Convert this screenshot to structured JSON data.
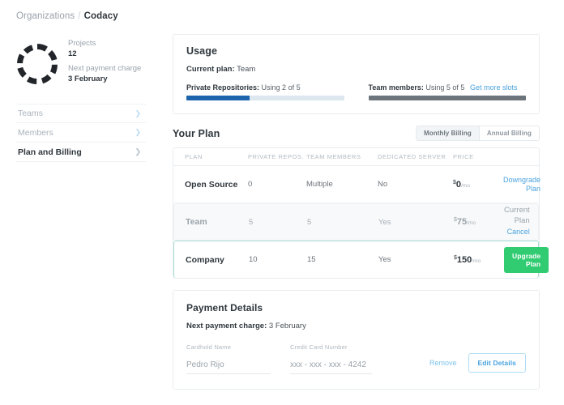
{
  "breadcrumb": {
    "parent": "Organizations",
    "separator": "/",
    "current": "Codacy"
  },
  "org": {
    "logo_icon": "codacy-dashed-circle-logo",
    "projects_label": "Projects",
    "projects_value": "12",
    "next_charge_label": "Next payment charge",
    "next_charge_value": "3 February"
  },
  "sidebar": {
    "items": [
      {
        "label": "Teams",
        "active": false,
        "chevron": "chevron-right-icon"
      },
      {
        "label": "Members",
        "active": false,
        "chevron": "chevron-right-icon"
      },
      {
        "label": "Plan and Billing",
        "active": true,
        "chevron": "chevron-right-icon"
      }
    ]
  },
  "usage": {
    "title": "Usage",
    "current_plan_label": "Current plan:",
    "current_plan_value": "Team",
    "repos": {
      "label": "Private Repositories:",
      "value": "Using 2 of 5",
      "used": 2,
      "total": 5,
      "percent": 40,
      "fill_color": "#1c64ad",
      "track_color": "#dce7ef"
    },
    "members": {
      "label": "Team members:",
      "value": "Using 5 of 5",
      "link": "Get more slots",
      "used": 5,
      "total": 5,
      "percent": 100,
      "fill_color": "#6d757c",
      "track_color": "#d5d9dd"
    }
  },
  "your_plan": {
    "title": "Your Plan",
    "billing_toggle": {
      "monthly": "Monthly Billing",
      "annual": "Annual Billing",
      "selected": "monthly"
    },
    "columns": [
      "PLAN",
      "PRIVATE REPOS.",
      "TEAM MEMBERS",
      "DEDICATED SERVER",
      "PRICE"
    ],
    "rows": [
      {
        "plan": "Open Source",
        "private_repos": "0",
        "team_members": "Multiple",
        "dedicated_server": "No",
        "currency": "$",
        "price": "0",
        "per": "/mo",
        "action_type": "link",
        "action_label": "Downgrade Plan",
        "state": "normal"
      },
      {
        "plan": "Team",
        "private_repos": "5",
        "team_members": "5",
        "dedicated_server": "Yes",
        "currency": "$",
        "price": "75",
        "per": "/mo",
        "action_type": "current",
        "action_label": "Current Plan",
        "action_sub_label": "Cancel",
        "state": "current"
      },
      {
        "plan": "Company",
        "private_repos": "10",
        "team_members": "15",
        "dedicated_server": "Yes",
        "currency": "$",
        "price": "150",
        "per": "/mo",
        "action_type": "button",
        "action_label": "Upgrade Plan",
        "state": "highlight"
      }
    ]
  },
  "payment": {
    "title": "Payment Details",
    "next_charge_label": "Next payment charge:",
    "next_charge_value": "3 February",
    "cardhold_name_label": "Cardhold Name",
    "cardhold_name_value": "Pedro Rijo",
    "card_number_label": "Credit Card Number",
    "card_number_value": "xxx - xxx - xxx - 4242",
    "remove_label": "Remove",
    "edit_label": "Edit Details"
  },
  "colors": {
    "accent_blue": "#4aa3df",
    "accent_green": "#31cb72",
    "highlight_border": "#a8ddd3",
    "bar_blue": "#1c64ad",
    "bar_gray": "#6d757c"
  }
}
